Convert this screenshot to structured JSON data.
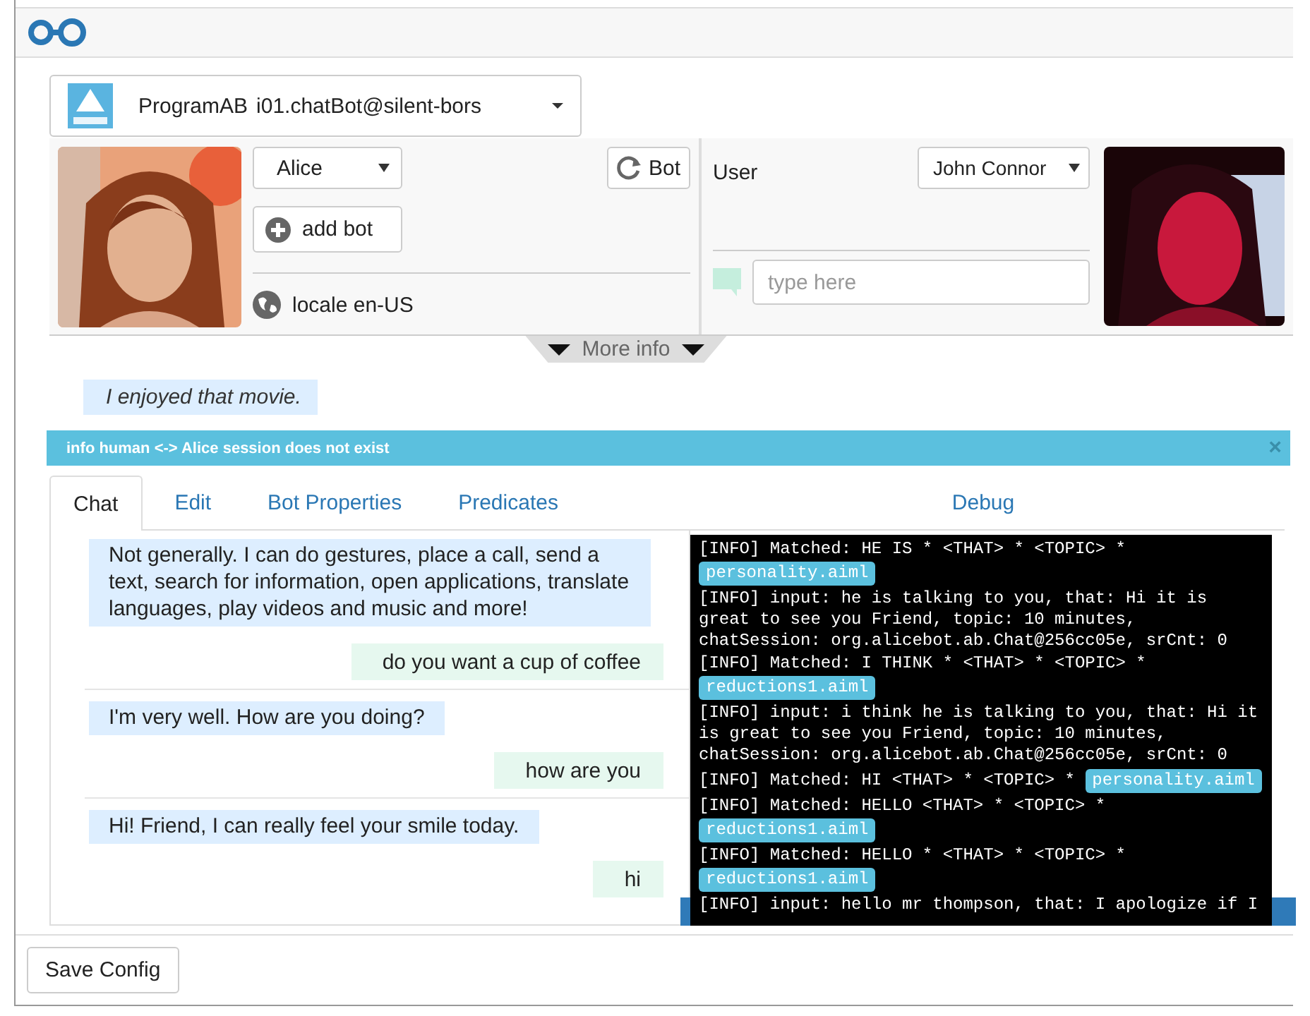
{
  "service": {
    "type": "ProgramAB",
    "name": "i01.chatBot@silent-bors"
  },
  "bot": {
    "selected_bot": "Alice",
    "refresh_label": "Bot",
    "add_label": "add bot",
    "locale": "locale en-US"
  },
  "user": {
    "label": "User",
    "selected_user": "John Connor",
    "input_placeholder": "type here"
  },
  "more_info": "More info",
  "last_input": "I enjoyed that movie.",
  "alert": {
    "text": "info human <-> Alice session does not exist",
    "close": "×"
  },
  "tabs": [
    {
      "label": "Chat",
      "selected": true,
      "kind": "chat"
    },
    {
      "label": "Edit",
      "selected": false,
      "kind": "chat"
    },
    {
      "label": "Bot Properties",
      "selected": false,
      "kind": "chat"
    },
    {
      "label": "Predicates",
      "selected": false,
      "kind": "chat"
    },
    {
      "label": "Debug",
      "selected": false,
      "kind": "debug"
    }
  ],
  "messages": [
    {
      "kind": "bot",
      "text": "Not generally. I can do gestures, place a call, send a text, search for information, open applications, translate languages, play videos and music and more!"
    },
    {
      "kind": "user",
      "text": "do you want a cup of coffee"
    },
    {
      "kind": "bot",
      "text": "I'm very well. How are you doing?"
    },
    {
      "kind": "user",
      "text": "how are you"
    },
    {
      "kind": "bot",
      "text": "Hi! Friend, I can really feel your smile today."
    },
    {
      "kind": "user",
      "text": "hi"
    }
  ],
  "debug_log": [
    {
      "text": "[INFO] Matched: HE IS * <THAT> * <TOPIC> *",
      "file": "personality.aiml"
    },
    {
      "text": "[INFO] input: he is talking to you, that: Hi it is great to see you Friend, topic: 10 minutes, chatSession: org.alicebot.ab.Chat@256cc05e, srCnt: 0"
    },
    {
      "text": "[INFO] Matched: I THINK * <THAT> * <TOPIC> *",
      "file": "reductions1.aiml"
    },
    {
      "text": "[INFO] input: i think he is talking to you, that: Hi it is great to see you Friend, topic: 10 minutes, chatSession: org.alicebot.ab.Chat@256cc05e, srCnt: 0"
    },
    {
      "text": "[INFO] Matched: HI <THAT> * <TOPIC> *",
      "file": "personality.aiml"
    },
    {
      "text": "[INFO] Matched: HELLO <THAT> * <TOPIC> *",
      "file": "reductions1.aiml"
    },
    {
      "text": "[INFO] Matched: HELLO * <THAT> * <TOPIC> *",
      "file": "reductions1.aiml"
    },
    {
      "text": "[INFO] input: hello mr thompson, that: I apologize if I"
    }
  ],
  "save_button": "Save Config"
}
